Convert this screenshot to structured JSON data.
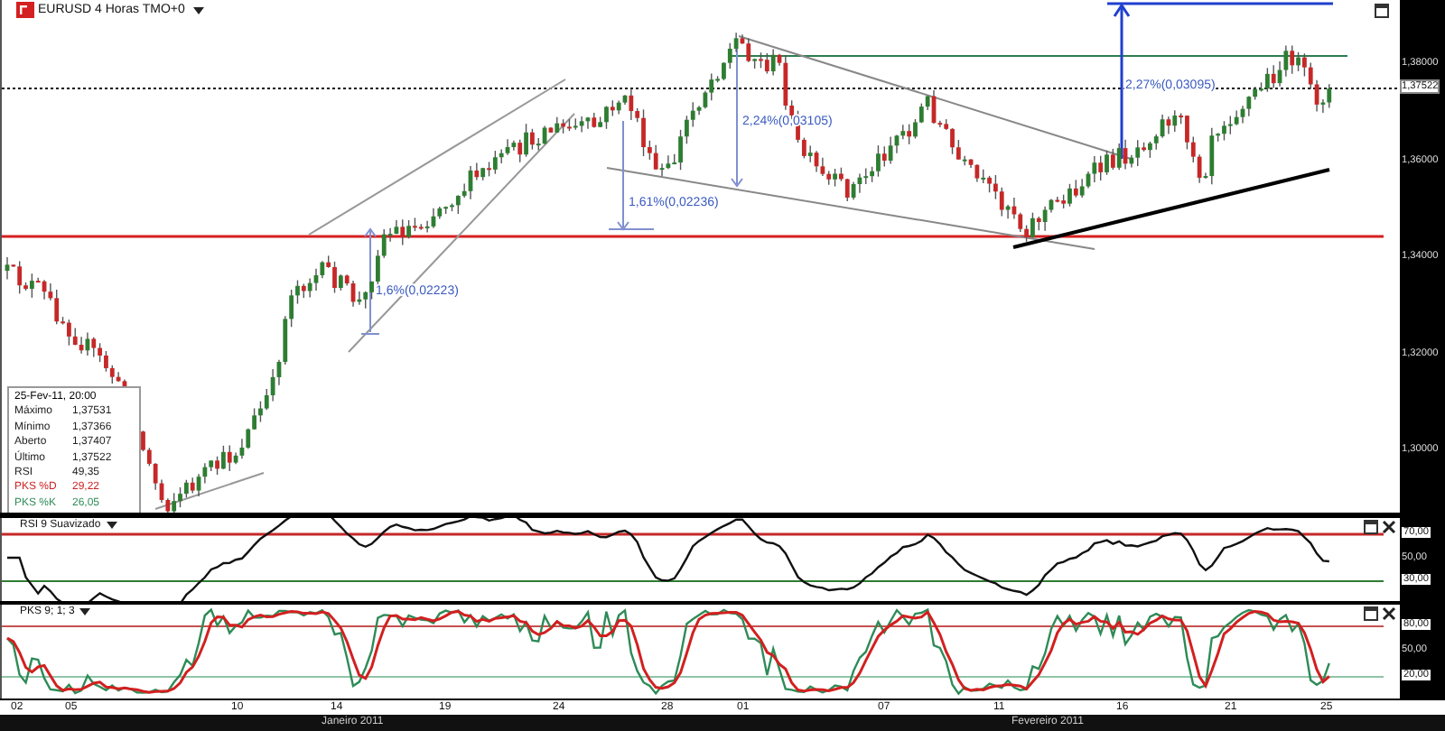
{
  "window": {
    "title": "EURUSD 4 Horas TMO+0"
  },
  "price_panel": {
    "axis_labels": [
      "1,38000",
      "1,36000",
      "1,34000",
      "1,32000",
      "1,30000"
    ],
    "last_price": "1,37522",
    "annotations": [
      {
        "text": "1,6%(0,02223)"
      },
      {
        "text": "2,24%(0,03105)"
      },
      {
        "text": "1,61%(0,02236)"
      },
      {
        "text": "2,27%(0,03095)"
      }
    ],
    "legend": {
      "date": "25-Fev-11, 20:00",
      "rows": [
        {
          "label": "Máximo",
          "value": "1,37531",
          "color": "#222222"
        },
        {
          "label": "Mínimo",
          "value": "1,37366",
          "color": "#222222"
        },
        {
          "label": "Aberto",
          "value": "1,37407",
          "color": "#222222"
        },
        {
          "label": "Último",
          "value": "1,37522",
          "color": "#222222"
        },
        {
          "label": "RSI",
          "value": "49,35",
          "color": "#222222"
        },
        {
          "label": "PKS %D",
          "value": "29,22",
          "color": "#cc2222"
        },
        {
          "label": "PKS %K",
          "value": "26,05",
          "color": "#2e8b57"
        }
      ]
    }
  },
  "rsi_panel": {
    "title": "RSI 9 Suavizado",
    "axis_labels": [
      "70,00",
      "50,00",
      "30,00"
    ]
  },
  "stochastic_panel": {
    "title": "PKS 9; 1; 3",
    "axis_labels": [
      "80,00",
      "50,00",
      "20,00"
    ]
  },
  "time_axis": {
    "days": [
      "02",
      "05",
      "10",
      "14",
      "19",
      "24",
      "28",
      "01",
      "07",
      "11",
      "16",
      "21",
      "25"
    ],
    "months": [
      "Janeiro 2011",
      "Fevereiro 2011"
    ]
  }
}
